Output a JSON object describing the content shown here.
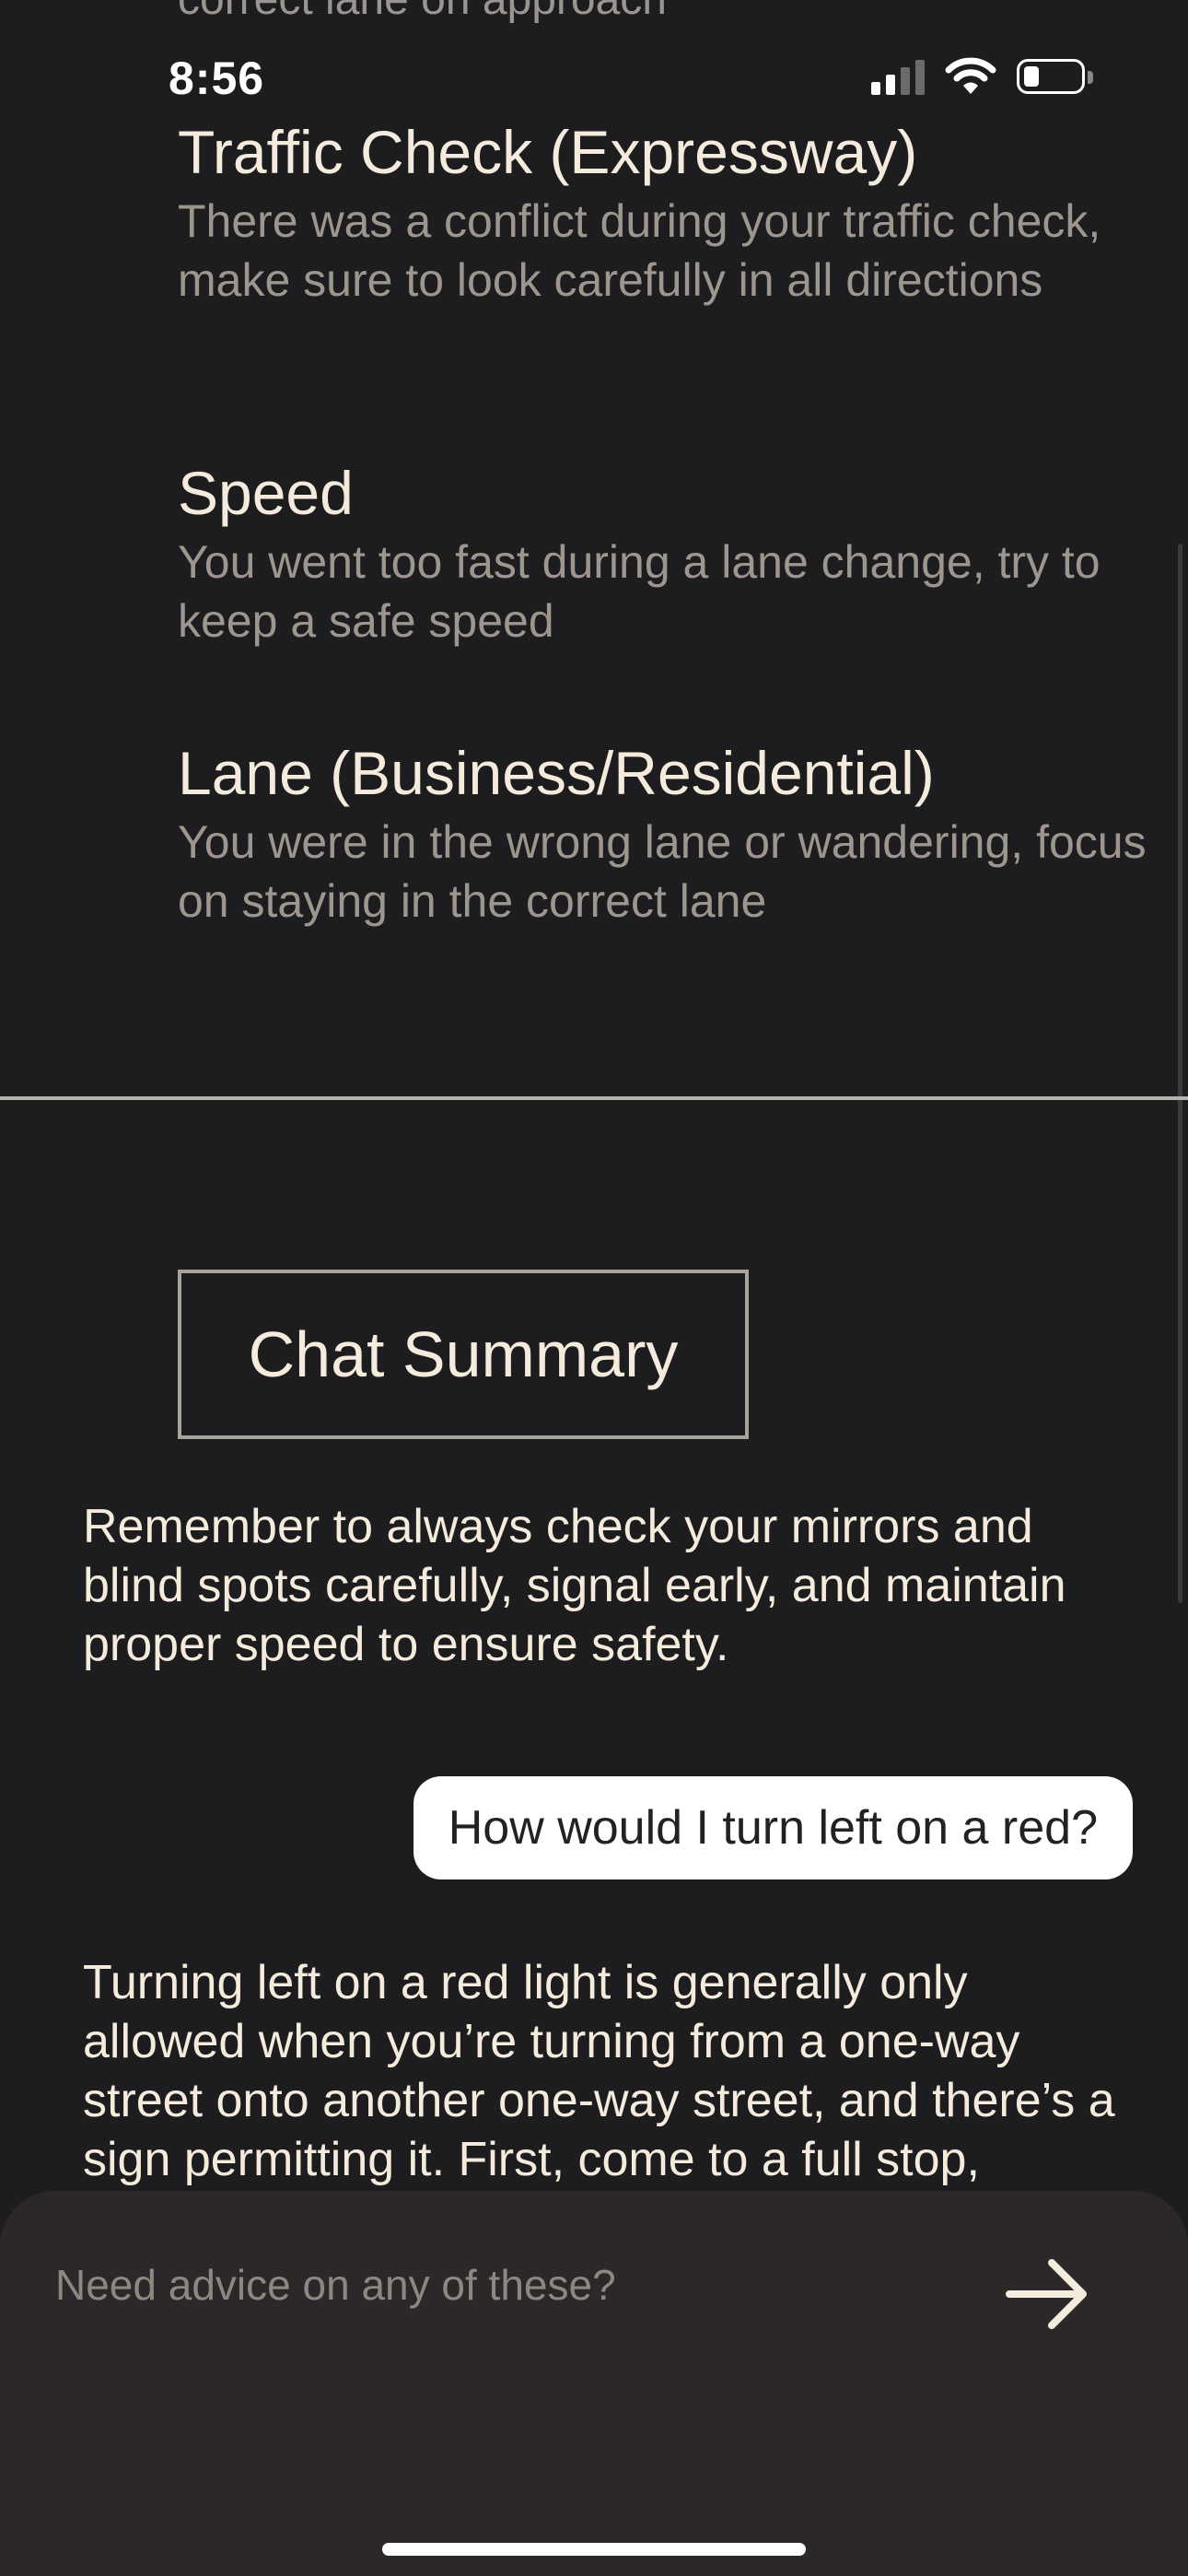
{
  "status_bar": {
    "time": "8:56"
  },
  "cutoff_text": "correct lane on approach",
  "issues": [
    {
      "title": "Traffic Check (Expressway)",
      "description": "There was a conflict during your traffic check, make sure to look carefully in all directions"
    },
    {
      "title": "Speed",
      "description": "You went too fast during a lane change, try to keep a safe speed"
    },
    {
      "title": "Lane (Business/Residential)",
      "description": "You were in the wrong lane or wandering, focus on staying in the correct lane"
    }
  ],
  "chat": {
    "summary_button_label": "Chat Summary",
    "summary_text": "Remember to always check your mirrors and blind spots carefully, signal early, and maintain proper speed to ensure safety.",
    "user_message": "How would I turn left on a red?",
    "assistant_reply": "Turning left on a red light is generally only allowed when you’re turning from a one-way street onto another one-way street, and there’s a sign permitting it. First, come to a full stop,"
  },
  "input": {
    "placeholder": "Need advice on any of these?",
    "value": ""
  },
  "icons": {
    "send": "arrow-right-icon",
    "signal": "cellular-signal-icon",
    "wifi": "wifi-icon",
    "battery": "battery-icon"
  },
  "colors": {
    "background": "#1d1d1f",
    "text_primary": "#f5ebdc",
    "text_secondary": "#9c968f",
    "input_sheet": "#2c2829",
    "bubble": "#ffffff"
  }
}
